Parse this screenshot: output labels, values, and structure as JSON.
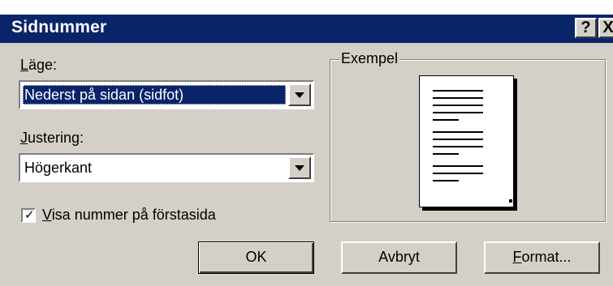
{
  "window": {
    "title": "Sidnummer",
    "help_button": "?",
    "close_button": "X"
  },
  "position": {
    "label_underlined": "L",
    "label_rest": "äge:",
    "selected_value": "Nederst på sidan (sidfot)"
  },
  "alignment": {
    "label_underlined": "J",
    "label_rest": "ustering:",
    "selected_value": "Högerkant"
  },
  "show_first_page": {
    "checked": true,
    "check_mark": "✓",
    "label_underlined": "V",
    "label_rest": "isa nummer på förstasida"
  },
  "preview": {
    "legend": "Exempel"
  },
  "buttons": {
    "ok": "OK",
    "cancel": "Avbryt",
    "format_underlined": "F",
    "format_rest": "ormat..."
  },
  "colors": {
    "titlebar": "#0a246a",
    "dialog_bg": "#d4d0c8",
    "selection": "#0a246a"
  }
}
